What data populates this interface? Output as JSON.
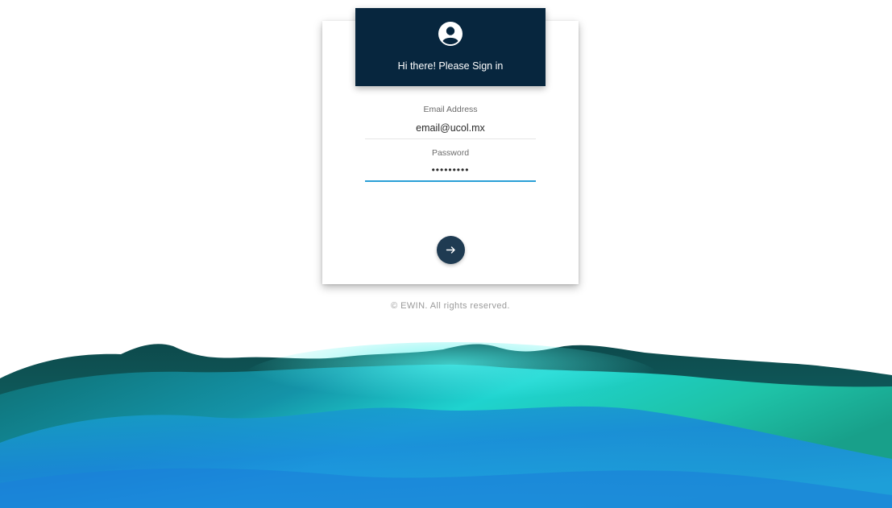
{
  "login_card": {
    "header": {
      "icon": "account-circle-icon",
      "title": "Hi there! Please Sign in",
      "background_color": "#07263e"
    },
    "email": {
      "label": "Email Address",
      "value": "email@ucol.mx"
    },
    "password": {
      "label": "Password",
      "value": "•••••••••"
    },
    "submit_button": {
      "icon": "arrow-right-icon",
      "color": "#1f3b52"
    }
  },
  "footer": {
    "text": "© EWIN. All rights reserved."
  },
  "colors": {
    "accent": "#2a9fd6",
    "landscape_dark": "#0b3b44",
    "landscape_teal": "#1fd6c8",
    "landscape_blue": "#1a7fd8"
  }
}
